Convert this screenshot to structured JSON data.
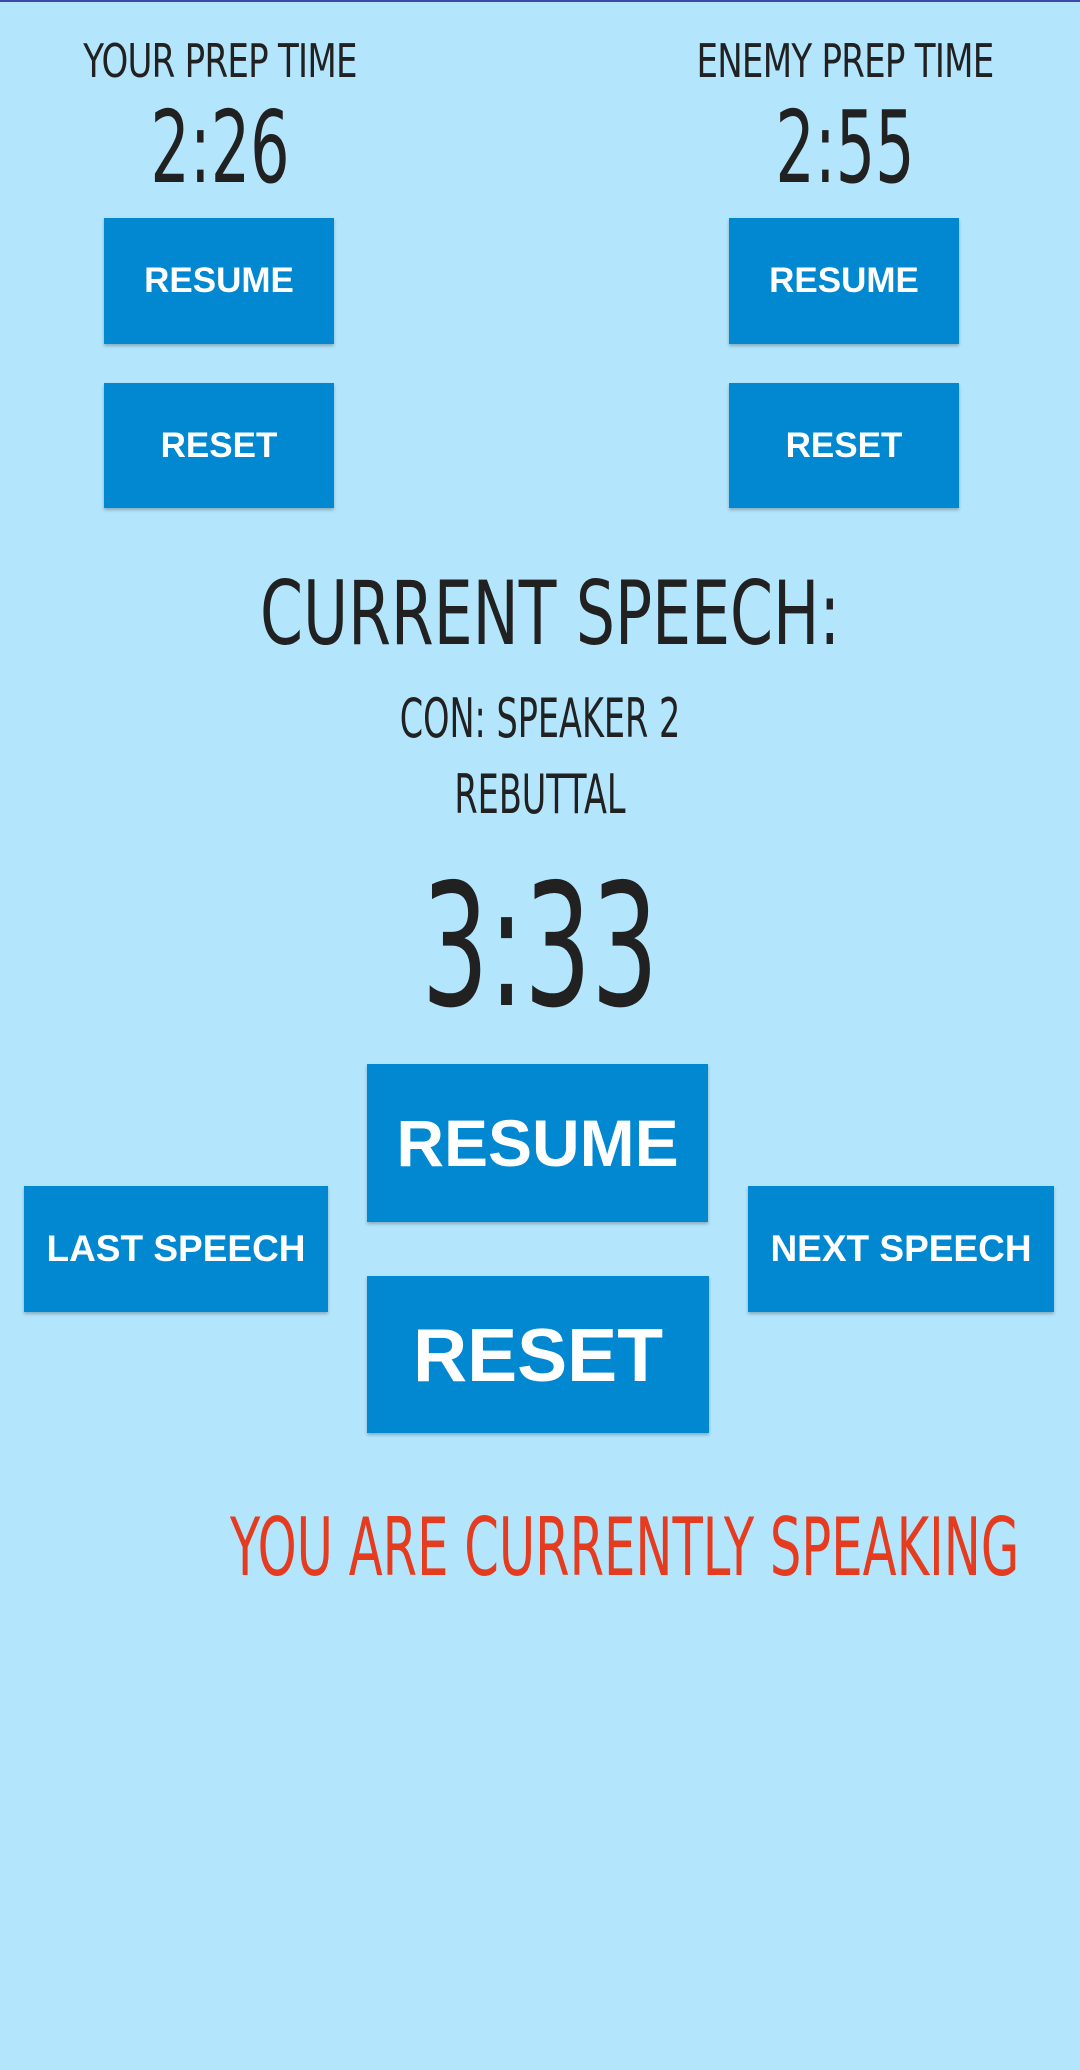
{
  "your_prep": {
    "label": "YOUR PREP TIME",
    "time": "2:26",
    "resume_label": "RESUME",
    "reset_label": "RESET"
  },
  "enemy_prep": {
    "label": "ENEMY PREP TIME",
    "time": "2:55",
    "resume_label": "RESUME",
    "reset_label": "RESET"
  },
  "current_speech": {
    "title": "CURRENT SPEECH:",
    "speaker": "CON: SPEAKER 2",
    "type": "REBUTTAL",
    "timer": "3:33",
    "resume_label": "RESUME",
    "reset_label": "RESET",
    "last_label": "LAST SPEECH",
    "next_label": "NEXT SPEECH"
  },
  "status": {
    "text": "YOU ARE CURRENTLY SPEAKING",
    "color": "#e53b1e"
  },
  "colors": {
    "background": "#b3e5fc",
    "button": "#0288d1",
    "text": "#212121"
  }
}
